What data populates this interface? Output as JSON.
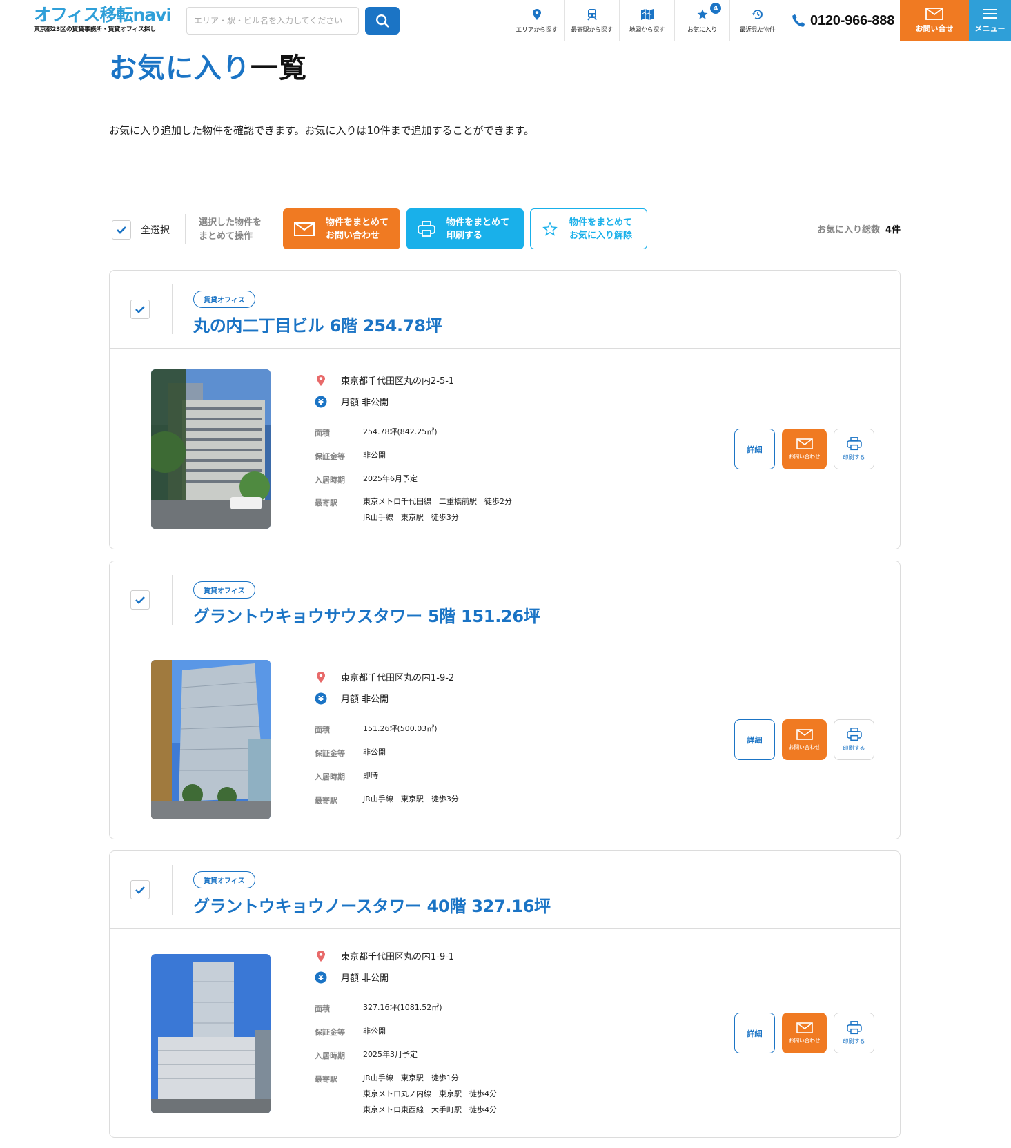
{
  "header": {
    "logo_text": "オフィス移転navi",
    "logo_tagline": "東京都23区の賃貸事務所・賃貸オフィス探し",
    "search_placeholder": "エリア・駅・ビル名を入力してください",
    "nav": [
      {
        "label": "エリアから探す",
        "icon": "map-pin-icon"
      },
      {
        "label": "最寄駅から探す",
        "icon": "train-icon"
      },
      {
        "label": "地図から探す",
        "icon": "map-icon"
      },
      {
        "label": "お気に入り",
        "icon": "star-icon",
        "badge": "4"
      },
      {
        "label": "最近見た物件",
        "icon": "history-icon"
      }
    ],
    "phone": "0120-966-888",
    "contact_label": "お問い合せ",
    "menu_label": "メニュー",
    "accent": "#1b74c5",
    "orange": "#f07a22",
    "cyan": "#19b0ea"
  },
  "page": {
    "title_main": "お気に入り",
    "title_dash": "一覧",
    "description": "お気に入り追加した物件を確認できます。お気に入りは10件まで追加することができます。"
  },
  "toolbar": {
    "select_all": "全選択",
    "hint_line1": "選択した物件を",
    "hint_line2": "まとめて操作",
    "btn_inquiry_1": "物件をまとめて",
    "btn_inquiry_2": "お問い合わせ",
    "btn_print_1": "物件をまとめて",
    "btn_print_2": "印刷する",
    "btn_unfav_1": "物件をまとめて",
    "btn_unfav_2": "お気に入り解除",
    "total_label": "お気に入り総数",
    "total_count": "4件"
  },
  "properties": [
    {
      "tag": "賃貸オフィス",
      "title": "丸の内二丁目ビル 6階 254.78坪",
      "address": "東京都千代田区丸の内2-5-1",
      "rent": "月額 非公開",
      "area_label": "面積",
      "area": "254.78坪(842.25㎡)",
      "deposit_label": "保証金等",
      "deposit": "非公開",
      "movein_label": "入居時期",
      "movein": "2025年6月予定",
      "station_label": "最寄駅",
      "stations": [
        "東京メトロ千代田線　二重橋前駅　徒歩2分",
        "JR山手線　東京駅　徒歩3分"
      ]
    },
    {
      "tag": "賃貸オフィス",
      "title": "グラントウキョウサウスタワー 5階 151.26坪",
      "address": "東京都千代田区丸の内1-9-2",
      "rent": "月額 非公開",
      "area_label": "面積",
      "area": "151.26坪(500.03㎡)",
      "deposit_label": "保証金等",
      "deposit": "非公開",
      "movein_label": "入居時期",
      "movein": "即時",
      "station_label": "最寄駅",
      "stations": [
        "JR山手線　東京駅　徒歩3分"
      ]
    },
    {
      "tag": "賃貸オフィス",
      "title": "グラントウキョウノースタワー 40階 327.16坪",
      "address": "東京都千代田区丸の内1-9-1",
      "rent": "月額 非公開",
      "area_label": "面積",
      "area": "327.16坪(1081.52㎡)",
      "deposit_label": "保証金等",
      "deposit": "非公開",
      "movein_label": "入居時期",
      "movein": "2025年3月予定",
      "station_label": "最寄駅",
      "stations": [
        "JR山手線　東京駅　徒歩1分",
        "東京メトロ丸ノ内線　東京駅　徒歩4分",
        "東京メトロ東西線　大手町駅　徒歩4分"
      ]
    }
  ],
  "actions": {
    "detail": "詳細",
    "inquiry": "お問い合わせ",
    "print": "印刷する"
  }
}
